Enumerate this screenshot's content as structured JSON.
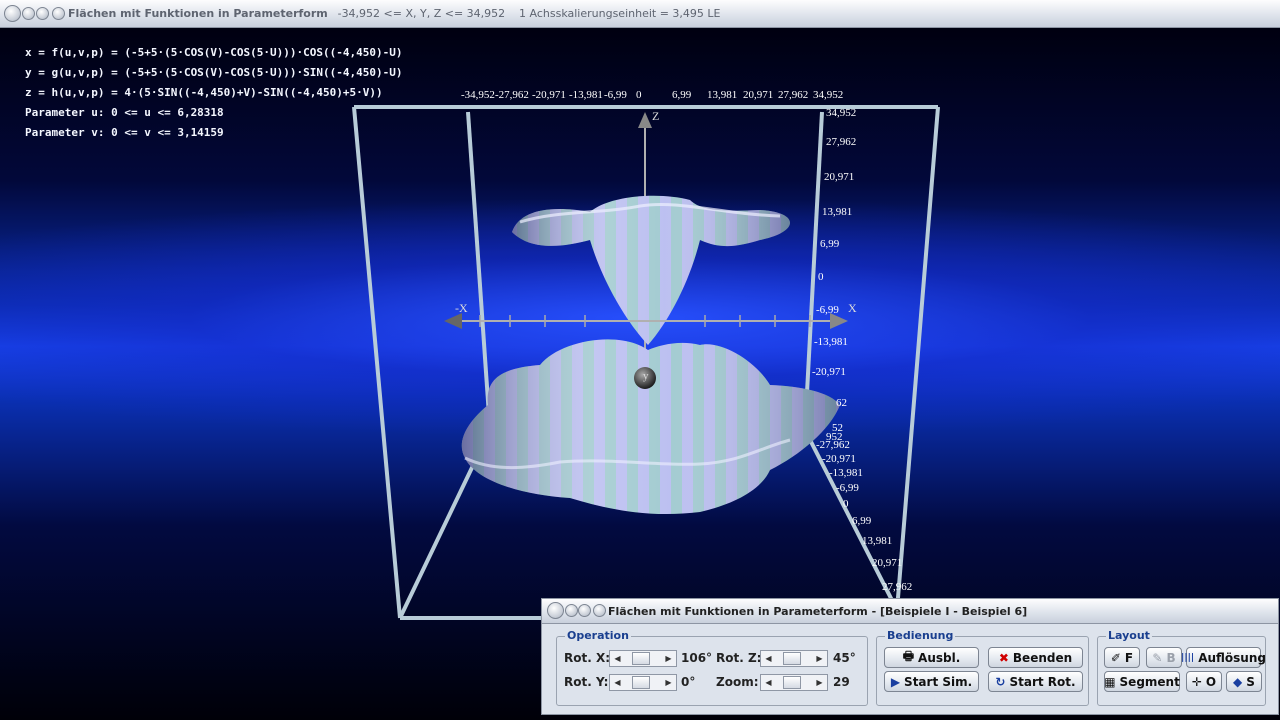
{
  "window": {
    "title": "Flächen mit Funktionen in Parameterform",
    "range": "-34,952 <= X, Y, Z <= 34,952",
    "scale": "1 Achsskalierungseinheit = 3,495 LE"
  },
  "formulas": [
    "x = f(u,v,p) = (-5+5·(5·COS(V)-COS(5·U)))·COS((-4,450)-U)",
    "y = g(u,v,p) = (-5+5·(5·COS(V)-COS(5·U)))·SIN((-4,450)-U)",
    "z = h(u,v,p) = 4·(5·SIN((-4,450)+V)-SIN((-4,450)+5·V))",
    "Parameter u: 0 <= u <= 6,28318",
    "Parameter v: 0 <= v <= 3,14159"
  ],
  "axes": {
    "x_label": "X",
    "neg_x_label": "-X",
    "z_label": "Z",
    "y_label": "y",
    "top_ticks": [
      "-34,952",
      "-27,962",
      "-20,971",
      "-13,981",
      "-6,99",
      "0",
      "6,99",
      "13,981",
      "20,971",
      "27,962",
      "34,952"
    ],
    "right_ticks": [
      "34,952",
      "27,962",
      "20,971",
      "13,981",
      "6,99",
      "0",
      "-6,99",
      "-13,981",
      "-20,971",
      "62"
    ],
    "front_ticks": [
      "52",
      "-27,962",
      "-20,971",
      "-13,981",
      "-6,99",
      "0",
      "6,99",
      "13,981",
      "20,971",
      "27,962"
    ],
    "front_ticks_extra": "952"
  },
  "panel": {
    "title": "Flächen mit Funktionen in Parameterform - [Beispiele I - Beispiel 6]",
    "operation": {
      "label": "Operation",
      "rot_x_label": "Rot. X:",
      "rot_x_value": "106°",
      "rot_y_label": "Rot. Y:",
      "rot_y_value": "0°",
      "rot_z_label": "Rot. Z:",
      "rot_z_value": "45°",
      "zoom_label": "Zoom:",
      "zoom_value": "29"
    },
    "bedienung": {
      "label": "Bedienung",
      "ausbl": "Ausbl.",
      "beenden": "Beenden",
      "start_sim": "Start Sim.",
      "start_rot": "Start Rot."
    },
    "layout": {
      "label": "Layout",
      "f": "F",
      "b": "B",
      "aufloesung": "Auflösung",
      "segment": "Segment",
      "o": "O",
      "s": "S"
    }
  }
}
